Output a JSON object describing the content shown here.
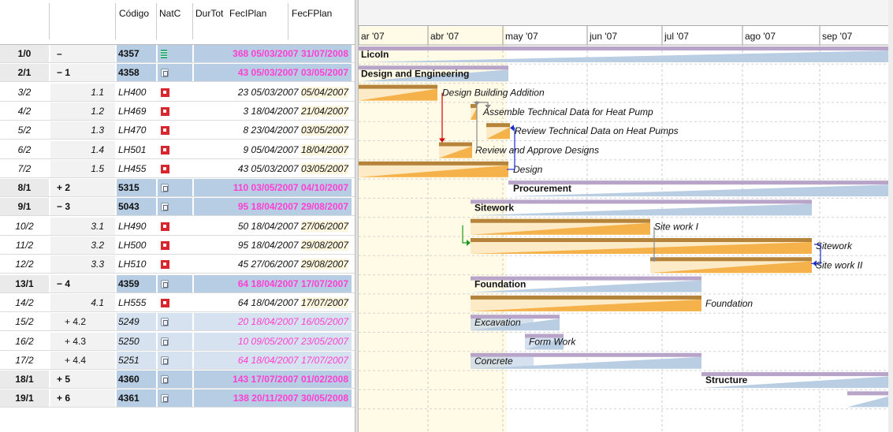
{
  "grid": {
    "headers": {
      "code": "Código",
      "nat": "NatC",
      "dur": "DurTot",
      "start": "FecIPlan",
      "end": "FecFPlan"
    },
    "rows": [
      {
        "idx": "1/0",
        "tree": "–",
        "code": "4357",
        "nat": "project",
        "dur": "368",
        "start": "05/03/2007",
        "end": "31/07/2008",
        "kind": "summary",
        "pinkDates": true
      },
      {
        "idx": "2/1",
        "tree": "− 1",
        "code": "4358",
        "nat": "summary",
        "dur": "43",
        "start": "05/03/2007",
        "end": "03/05/2007",
        "kind": "summary",
        "pinkDates": true
      },
      {
        "idx": "3/2",
        "tree": "1.1",
        "code": "LH400",
        "nat": "task",
        "dur": "23",
        "start": "05/03/2007",
        "end": "05/04/2007",
        "kind": "task",
        "pinkDates": false
      },
      {
        "idx": "4/2",
        "tree": "1.2",
        "code": "LH469",
        "nat": "task",
        "dur": "3",
        "start": "18/04/2007",
        "end": "21/04/2007",
        "kind": "task",
        "pinkDates": false
      },
      {
        "idx": "5/2",
        "tree": "1.3",
        "code": "LH470",
        "nat": "task",
        "dur": "8",
        "start": "23/04/2007",
        "end": "03/05/2007",
        "kind": "task",
        "pinkDates": false
      },
      {
        "idx": "6/2",
        "tree": "1.4",
        "code": "LH501",
        "nat": "task",
        "dur": "9",
        "start": "05/04/2007",
        "end": "18/04/2007",
        "kind": "task",
        "pinkDates": false
      },
      {
        "idx": "7/2",
        "tree": "1.5",
        "code": "LH455",
        "nat": "task",
        "dur": "43",
        "start": "05/03/2007",
        "end": "03/05/2007",
        "kind": "task",
        "pinkDates": false
      },
      {
        "idx": "8/1",
        "tree": "+ 2",
        "code": "5315",
        "nat": "summary",
        "dur": "110",
        "start": "03/05/2007",
        "end": "04/10/2007",
        "kind": "summary",
        "pinkDates": true
      },
      {
        "idx": "9/1",
        "tree": "− 3",
        "code": "5043",
        "nat": "summary",
        "dur": "95",
        "start": "18/04/2007",
        "end": "29/08/2007",
        "kind": "summary",
        "pinkDates": true
      },
      {
        "idx": "10/2",
        "tree": "3.1",
        "code": "LH490",
        "nat": "task",
        "dur": "50",
        "start": "18/04/2007",
        "end": "27/06/2007",
        "kind": "task",
        "pinkDates": false
      },
      {
        "idx": "11/2",
        "tree": "3.2",
        "code": "LH500",
        "nat": "task",
        "dur": "95",
        "start": "18/04/2007",
        "end": "29/08/2007",
        "kind": "task",
        "pinkDates": false
      },
      {
        "idx": "12/2",
        "tree": "3.3",
        "code": "LH510",
        "nat": "task",
        "dur": "45",
        "start": "27/06/2007",
        "end": "29/08/2007",
        "kind": "task",
        "pinkDates": false
      },
      {
        "idx": "13/1",
        "tree": "− 4",
        "code": "4359",
        "nat": "summary",
        "dur": "64",
        "start": "18/04/2007",
        "end": "17/07/2007",
        "kind": "summary",
        "pinkDates": true
      },
      {
        "idx": "14/2",
        "tree": "4.1",
        "code": "LH555",
        "nat": "task",
        "dur": "64",
        "start": "18/04/2007",
        "end": "17/07/2007",
        "kind": "task",
        "pinkDates": false
      },
      {
        "idx": "15/2",
        "tree": "+ 4.2",
        "code": "5249",
        "nat": "summary",
        "dur": "20",
        "start": "18/04/2007",
        "end": "16/05/2007",
        "kind": "sub",
        "pinkDates": true
      },
      {
        "idx": "16/2",
        "tree": "+ 4.3",
        "code": "5250",
        "nat": "summary",
        "dur": "10",
        "start": "09/05/2007",
        "end": "23/05/2007",
        "kind": "sub",
        "pinkDates": true
      },
      {
        "idx": "17/2",
        "tree": "+ 4.4",
        "code": "5251",
        "nat": "summary",
        "dur": "64",
        "start": "18/04/2007",
        "end": "17/07/2007",
        "kind": "sub",
        "pinkDates": true
      },
      {
        "idx": "18/1",
        "tree": "+ 5",
        "code": "4360",
        "nat": "summary",
        "dur": "143",
        "start": "17/07/2007",
        "end": "01/02/2008",
        "kind": "summary",
        "pinkDates": true
      },
      {
        "idx": "19/1",
        "tree": "+ 6",
        "code": "4361",
        "nat": "summary",
        "dur": "138",
        "start": "20/11/2007",
        "end": "30/05/2008",
        "kind": "summary",
        "pinkDates": true
      }
    ]
  },
  "timeline": {
    "months": [
      "ar '07",
      "abr '07",
      "may '07",
      "jun '07",
      "jul '07",
      "ago '07",
      "sep '07"
    ],
    "bars": [
      {
        "row": 0,
        "label": "LicoIn",
        "style": "summary-bold"
      },
      {
        "row": 1,
        "label": "Design and Engineering",
        "style": "summary-bold"
      },
      {
        "row": 2,
        "label": "Design Building Addition",
        "style": "task"
      },
      {
        "row": 3,
        "label": "Assemble Technical Data for Heat Pump",
        "style": "task"
      },
      {
        "row": 4,
        "label": "Review Technical Data on Heat Pumps",
        "style": "task"
      },
      {
        "row": 5,
        "label": "Review and Approve Designs",
        "style": "task"
      },
      {
        "row": 6,
        "label": "Design",
        "style": "task"
      },
      {
        "row": 7,
        "label": "Procurement",
        "style": "summary-bold"
      },
      {
        "row": 8,
        "label": "Sitework",
        "style": "summary-bold"
      },
      {
        "row": 9,
        "label": "Site work I",
        "style": "task"
      },
      {
        "row": 10,
        "label": "Sitework",
        "style": "task"
      },
      {
        "row": 11,
        "label": "Site work II",
        "style": "task"
      },
      {
        "row": 12,
        "label": "Foundation",
        "style": "summary-bold"
      },
      {
        "row": 13,
        "label": "Foundation",
        "style": "task"
      },
      {
        "row": 14,
        "label": "Excavation",
        "style": "task"
      },
      {
        "row": 15,
        "label": "Form Work",
        "style": "task"
      },
      {
        "row": 16,
        "label": "Concrete",
        "style": "task"
      },
      {
        "row": 17,
        "label": "Structure",
        "style": "summary-bold"
      },
      {
        "row": 18,
        "label": "",
        "style": "summary-bold"
      }
    ]
  },
  "colors": {
    "summary_bar": "#b9cde3",
    "summary_top": "#b7a4c8",
    "task_fill": "#f5b24a",
    "task_shade": "#fdebc7",
    "task_dark": "#b5833a",
    "link_red": "#d40000",
    "link_blue": "#1a2ec8",
    "link_gray": "#8a8a8a",
    "link_green": "#1a9a1a",
    "date_pink": "#ff3fd2",
    "header_blue": "#b7cde4"
  }
}
